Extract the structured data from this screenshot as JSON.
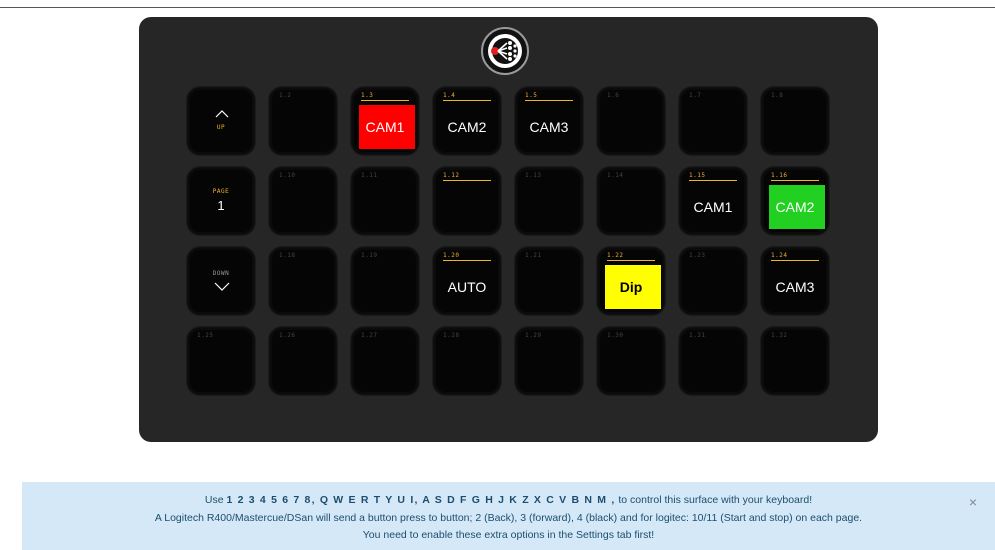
{
  "surface": {
    "nav": {
      "up_label": "UP",
      "page_label": "PAGE",
      "page_number": "1",
      "down_label": "DOWN"
    },
    "keys": [
      {
        "id": "1.2",
        "label": "",
        "bg": "",
        "named": false
      },
      {
        "id": "1.3",
        "label": "CAM1",
        "bg": "#ff0000",
        "named": true
      },
      {
        "id": "1.4",
        "label": "CAM2",
        "bg": "",
        "named": true
      },
      {
        "id": "1.5",
        "label": "CAM3",
        "bg": "",
        "named": true
      },
      {
        "id": "1.6",
        "label": "",
        "bg": "",
        "named": false
      },
      {
        "id": "1.7",
        "label": "",
        "bg": "",
        "named": false
      },
      {
        "id": "1.8",
        "label": "",
        "bg": "",
        "named": false
      },
      {
        "id": "1.10",
        "label": "",
        "bg": "",
        "named": false
      },
      {
        "id": "1.11",
        "label": "",
        "bg": "",
        "named": false
      },
      {
        "id": "1.12",
        "label": "",
        "bg": "",
        "named": true
      },
      {
        "id": "1.13",
        "label": "",
        "bg": "",
        "named": false
      },
      {
        "id": "1.14",
        "label": "",
        "bg": "",
        "named": false
      },
      {
        "id": "1.15",
        "label": "CAM1",
        "bg": "",
        "named": true
      },
      {
        "id": "1.16",
        "label": "CAM2",
        "bg": "#22d022",
        "named": true
      },
      {
        "id": "1.18",
        "label": "",
        "bg": "",
        "named": false
      },
      {
        "id": "1.19",
        "label": "",
        "bg": "",
        "named": false
      },
      {
        "id": "1.20",
        "label": "AUTO",
        "bg": "",
        "named": true
      },
      {
        "id": "1.21",
        "label": "",
        "bg": "",
        "named": false
      },
      {
        "id": "1.22",
        "label": "Dip",
        "bg": "#ffff00",
        "named": true,
        "dark": true
      },
      {
        "id": "1.23",
        "label": "",
        "bg": "",
        "named": false
      },
      {
        "id": "1.24",
        "label": "CAM3",
        "bg": "",
        "named": true
      },
      {
        "id": "1.25",
        "label": "",
        "bg": "",
        "named": false
      },
      {
        "id": "1.26",
        "label": "",
        "bg": "",
        "named": false
      },
      {
        "id": "1.27",
        "label": "",
        "bg": "",
        "named": false
      },
      {
        "id": "1.28",
        "label": "",
        "bg": "",
        "named": false
      },
      {
        "id": "1.29",
        "label": "",
        "bg": "",
        "named": false
      },
      {
        "id": "1.30",
        "label": "",
        "bg": "",
        "named": false
      },
      {
        "id": "1.31",
        "label": "",
        "bg": "",
        "named": false
      },
      {
        "id": "1.32",
        "label": "",
        "bg": "",
        "named": false
      }
    ]
  },
  "banner": {
    "line1_pre": "Use ",
    "line1_keys": "1 2 3 4 5 6 7 8, Q W E R T Y U I, A S D F G H J K Z X C V B N M ,",
    "line1_post": " to control this surface with your keyboard!",
    "line2": "A Logitech R400/Mastercue/DSan will send a button press to button; 2 (Back), 3 (forward), 4 (black) and for logitec: 10/11 (Start and stop) on each page.",
    "line3": "You need to enable these extra options in the Settings tab first!",
    "close": "×"
  }
}
